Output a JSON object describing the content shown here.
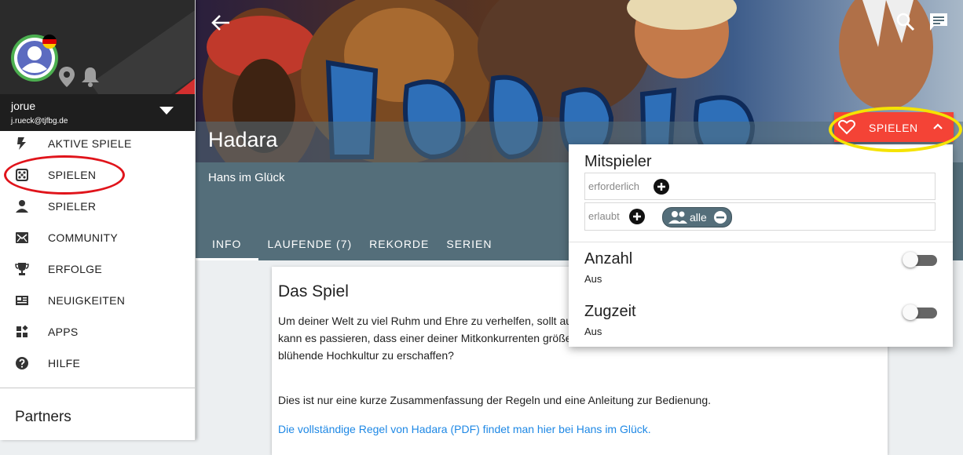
{
  "sidebar": {
    "user": {
      "name": "jorue",
      "email": "j.rueck@tjfbg.de"
    },
    "items": [
      {
        "label": "AKTIVE SPIELE",
        "icon": "lightning-icon"
      },
      {
        "label": "SPIELEN",
        "icon": "dice-icon"
      },
      {
        "label": "SPIELER",
        "icon": "person-icon"
      },
      {
        "label": "COMMUNITY",
        "icon": "mail-icon"
      },
      {
        "label": "ERFOLGE",
        "icon": "trophy-icon"
      },
      {
        "label": "NEUIGKEITEN",
        "icon": "newspaper-icon"
      },
      {
        "label": "APPS",
        "icon": "apps-icon"
      },
      {
        "label": "HILFE",
        "icon": "help-icon"
      }
    ],
    "partners_heading": "Partners"
  },
  "header": {
    "game_title": "Hadara",
    "publisher": "Hans im Glück",
    "tabs": [
      "INFO",
      "LAUFENDE (7)",
      "REKORDE",
      "SERIEN"
    ],
    "active_tab": "INFO"
  },
  "card": {
    "title": "Das Spiel",
    "paragraph1": "Um deiner Welt zu viel Ruhm und Ehre zu verhelfen, sollt aussuchen. Dabei solltest du aber die Landwirtschaft, di sonst kann es passieren, dass einer deiner Mitkonkurrenten größer und erfolgreicher wird. Wem gelingt es zuerst, eine neue blühende Hochkultur zu erschaffen?",
    "paragraph2": "Dies ist nur eine kurze Zusammenfassung der Regeln und eine Anleitung zur Bedienung.",
    "link": "Die vollständige Regel von Hadara (PDF) findet man hier bei Hans im Glück."
  },
  "play_button": {
    "label": "SPIELEN",
    "color": "#f44336"
  },
  "popup": {
    "players_heading": "Mitspieler",
    "required_placeholder": "erforderlich",
    "allowed_placeholder": "erlaubt",
    "chip_label": "alle",
    "count_heading": "Anzahl",
    "count_state": "Aus",
    "timer_heading": "Zugzeit",
    "timer_state": "Aus"
  },
  "colors": {
    "header_band": "#546e7a",
    "accent_red": "#f44336",
    "link": "#1e88e5",
    "highlight": "#f5e300"
  }
}
